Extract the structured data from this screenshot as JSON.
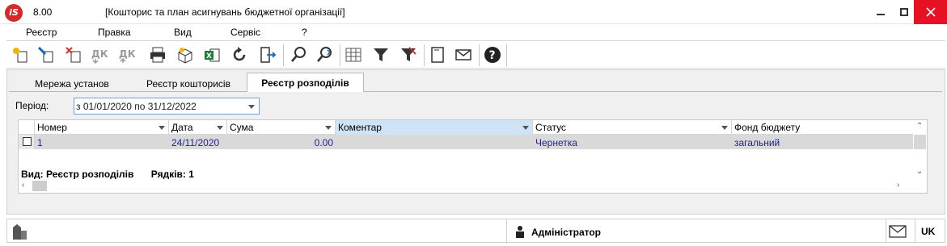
{
  "app": {
    "version": "8.00",
    "title": "[Кошторис та план асигнувань бюджетної організації]",
    "logo_text": "iS"
  },
  "menu": [
    "Реєстр",
    "Правка",
    "Вид",
    "Сервіс",
    "?"
  ],
  "toolbar": {
    "icons": [
      "new-icon",
      "edit-icon",
      "delete-icon",
      "debit-credit-icon",
      "debit-credit-2-icon",
      "print-icon",
      "package-icon",
      "excel-icon",
      "refresh-icon",
      "exit-icon",
      "search-icon",
      "search-next-icon",
      "grid-icon",
      "filter-icon",
      "clear-filter-icon",
      "notes-icon",
      "mail-icon",
      "help-icon"
    ]
  },
  "tabs": [
    {
      "label": "Мережа установ",
      "active": false
    },
    {
      "label": "Реєстр кошторисів",
      "active": false
    },
    {
      "label": "Реєстр розподілів",
      "active": true
    }
  ],
  "filter": {
    "label": "Період:",
    "value": "з 01/01/2020 по 31/12/2022"
  },
  "table": {
    "columns": [
      "Номер",
      "Дата",
      "Сума",
      "Коментар",
      "Статус",
      "Фонд бюджету"
    ],
    "rows": [
      {
        "number": "1",
        "date": "24/11/2020",
        "sum": "0.00",
        "comment": "",
        "status": "Чернетка",
        "fund": "загальний"
      }
    ]
  },
  "footer": {
    "view": "Вид: Реєстр розподілів",
    "rows": "Рядків: 1"
  },
  "statusbar": {
    "user": "Адміністратор",
    "lang": "UK"
  },
  "colors": {
    "accent": "#cfe3f7",
    "close": "#e81123",
    "row_text": "#1f1f8f",
    "logo": "#d42a2a"
  }
}
